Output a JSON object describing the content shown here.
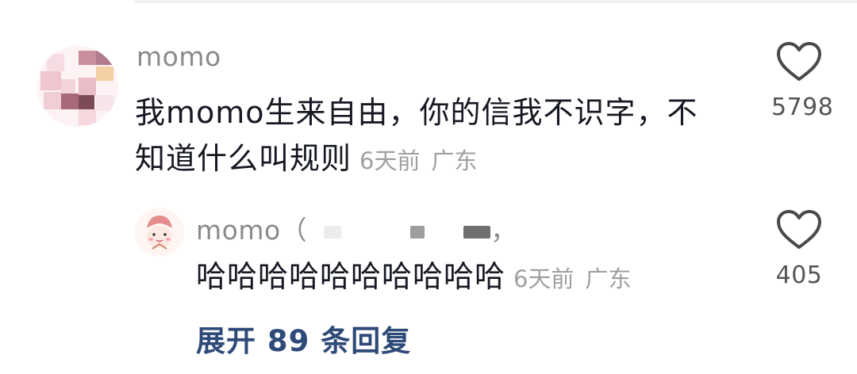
{
  "icons": {
    "like": "heart-outline-icon"
  },
  "colors": {
    "link": "#2e4a78",
    "meta": "#a0a0a0",
    "text": "#161823"
  },
  "comment": {
    "username": "momo",
    "text_line1": "我momo生来自由，你的信我不识字，不",
    "text_line2": "知道什么叫规则",
    "time": "6天前",
    "location": "广东",
    "likes": "5798"
  },
  "reply": {
    "username": "momo（",
    "username_tail": "，",
    "text": "哈哈哈哈哈哈哈哈哈哈",
    "time": "6天前",
    "location": "广东",
    "likes": "405"
  },
  "expand": {
    "label": "展开 89 条回复"
  }
}
